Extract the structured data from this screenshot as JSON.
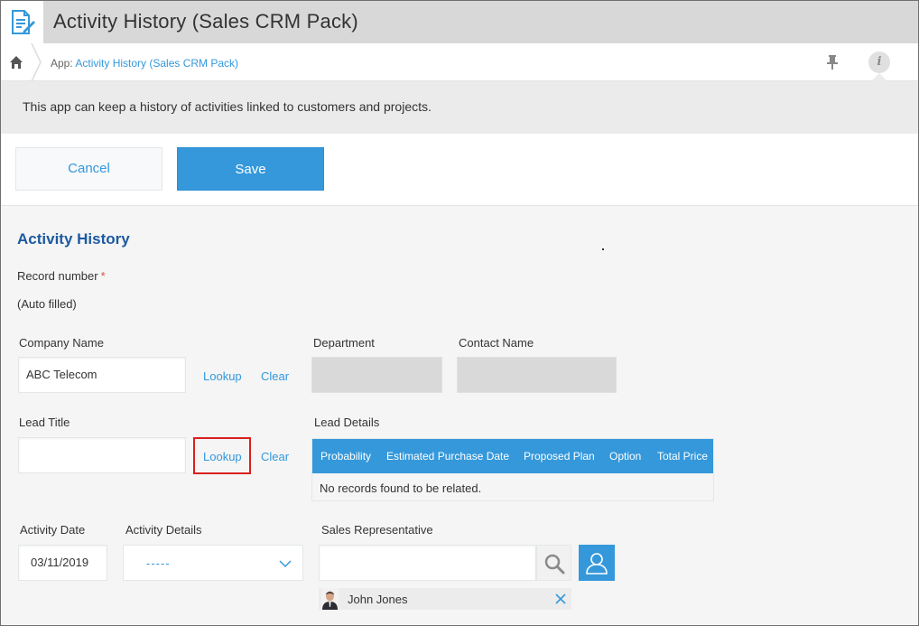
{
  "header": {
    "title": "Activity History (Sales CRM Pack)"
  },
  "breadcrumb": {
    "prefix": "App: ",
    "app_link": "Activity History (Sales CRM Pack)"
  },
  "info_button": {
    "glyph": "i"
  },
  "description": "This app can keep a history of activities linked to customers and projects.",
  "actions": {
    "cancel": "Cancel",
    "save": "Save"
  },
  "form": {
    "section_title": "Activity History",
    "record_number": {
      "label": "Record number",
      "required_mark": "*",
      "value": "(Auto filled)"
    },
    "company_name": {
      "label": "Company Name",
      "value": "ABC Telecom",
      "lookup": "Lookup",
      "clear": "Clear"
    },
    "department": {
      "label": "Department"
    },
    "contact_name": {
      "label": "Contact Name"
    },
    "lead_title": {
      "label": "Lead Title",
      "value": "",
      "lookup": "Lookup",
      "clear": "Clear"
    },
    "lead_details": {
      "label": "Lead Details",
      "columns": [
        "Probability",
        "Estimated Purchase Date",
        "Proposed Plan",
        "Option",
        "Total Price"
      ],
      "empty_message": "No records found to be related."
    },
    "activity_date": {
      "label": "Activity Date",
      "value": "03/11/2019"
    },
    "activity_details": {
      "label": "Activity Details",
      "selected": "-----"
    },
    "sales_representative": {
      "label": "Sales Representative",
      "search_value": "",
      "selected_user": "John Jones"
    }
  },
  "colors": {
    "accent": "#3498db",
    "title_blue": "#1d5aa0",
    "required": "#e74c3c",
    "highlight": "#d9201e"
  }
}
